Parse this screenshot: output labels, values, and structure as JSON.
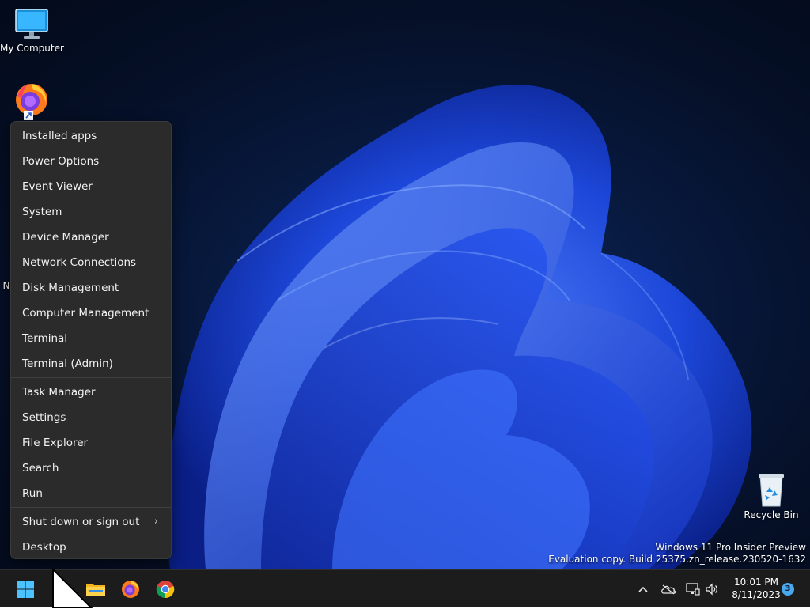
{
  "desktop": {
    "icons": [
      {
        "label": "My Computer",
        "icon": "monitor-icon"
      },
      {
        "label": "",
        "icon": "firefox-icon"
      },
      {
        "label": "N",
        "icon": "network-icon"
      },
      {
        "label": "Recycle Bin",
        "icon": "recycle-bin-icon"
      }
    ],
    "watermark": {
      "line1": "Windows 11 Pro Insider Preview",
      "line2": "Evaluation copy. Build 25375.zn_release.230520-1632"
    }
  },
  "context_menu": {
    "group1": [
      "Installed apps",
      "Power Options",
      "Event Viewer",
      "System",
      "Device Manager",
      "Network Connections",
      "Disk Management",
      "Computer Management",
      "Terminal",
      "Terminal (Admin)"
    ],
    "group2": [
      "Task Manager",
      "Settings",
      "File Explorer",
      "Search",
      "Run"
    ],
    "group3": [
      "Shut down or sign out",
      "Desktop"
    ],
    "submenu_arrow": "›"
  },
  "taskbar": {
    "start_icon": "windows-start-icon",
    "apps": [
      "file-explorer-icon",
      "firefox-icon",
      "chrome-icon"
    ],
    "tray": {
      "chevron": "^",
      "icons": [
        "onedrive-icon",
        "network-icon",
        "volume-icon"
      ]
    },
    "clock": {
      "time": "10:01 PM",
      "date": "8/11/2023"
    },
    "notification_count": "3"
  },
  "colors": {
    "accent": "#4aa8ee",
    "menu_bg": "#2b2b2b",
    "taskbar_bg": "#1c1c1c"
  }
}
